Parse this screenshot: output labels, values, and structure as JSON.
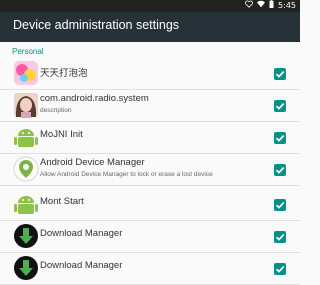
{
  "status_bar": {
    "time": "5:45",
    "icons": [
      "heart-icon",
      "wifi-icon",
      "battery-icon"
    ]
  },
  "app_bar": {
    "title": "Device administration settings"
  },
  "section": {
    "header": "Personal"
  },
  "items": [
    {
      "title": "天天打泡泡",
      "subtitle": "",
      "icon": "bubble-game-icon",
      "checked": true
    },
    {
      "title": "com.android.radio.system",
      "subtitle": "description",
      "icon": "girl-avatar-icon",
      "checked": true
    },
    {
      "title": "MoJNI Init",
      "subtitle": "",
      "icon": "android-icon",
      "checked": true
    },
    {
      "title": "Android Device Manager",
      "subtitle": "Allow Android Device Manager to lock or erase a lost device",
      "icon": "device-manager-icon",
      "checked": true
    },
    {
      "title": "Mont Start",
      "subtitle": "",
      "icon": "android-icon",
      "checked": true
    },
    {
      "title": "Download Manager",
      "subtitle": "",
      "icon": "download-icon",
      "checked": true
    },
    {
      "title": "Download Manager",
      "subtitle": "",
      "icon": "download-icon",
      "checked": true
    }
  ],
  "colors": {
    "app_bar": "#263238",
    "accent": "#0b8f8a",
    "status_bar": "#222222"
  }
}
